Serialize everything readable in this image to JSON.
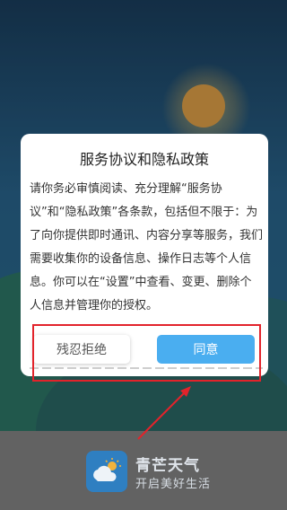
{
  "dialog": {
    "title": "服务协议和隐私政策",
    "body": "请你务必审慎阅读、充分理解“服务协议”和“隐私政策”各条款，包括但不限于：为了向你提供即时通讯、内容分享等服务，我们需要收集你的设备信息、操作日志等个人信息。你可以在“设置”中查看、变更、删除个人信息并管理你的授权。",
    "refuse_label": "残忍拒绝",
    "agree_label": "同意"
  },
  "app": {
    "name": "青芒天气",
    "slogan": "开启美好生活"
  },
  "colors": {
    "accent": "#4aaef0",
    "annotation": "#e2232b"
  },
  "icons": {
    "app_icon": "cloud-sun-icon"
  }
}
